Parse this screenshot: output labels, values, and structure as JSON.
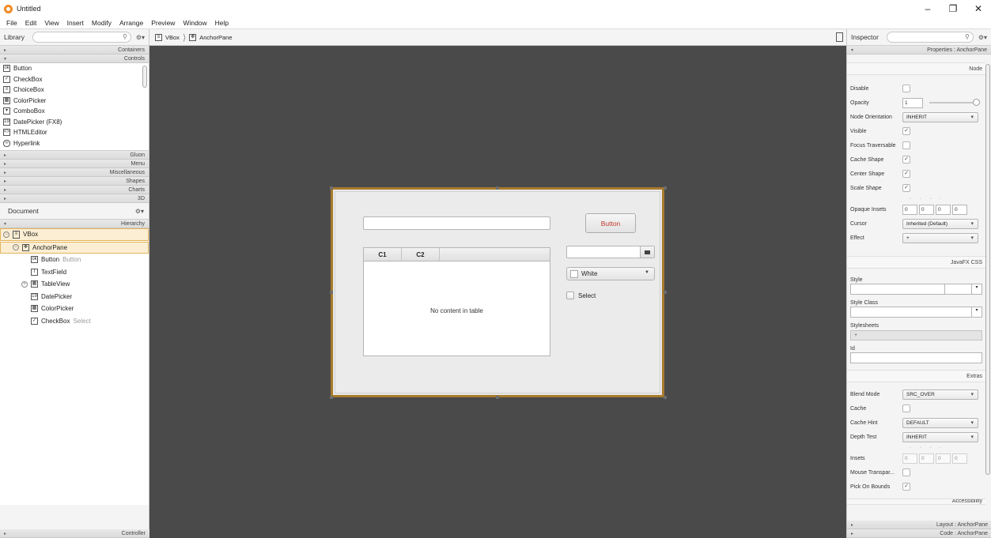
{
  "window": {
    "title": "Untitled",
    "controls": [
      "–",
      "❐",
      "✕"
    ]
  },
  "menubar": [
    "File",
    "Edit",
    "View",
    "Insert",
    "Modify",
    "Arrange",
    "Preview",
    "Window",
    "Help"
  ],
  "library": {
    "title": "Library",
    "sections_top": [
      "Containers",
      "Controls"
    ],
    "controls": [
      {
        "label": "Button",
        "icon": "button-icon"
      },
      {
        "label": "CheckBox",
        "icon": "checkbox-icon"
      },
      {
        "label": "ChoiceBox",
        "icon": "choicebox-icon"
      },
      {
        "label": "ColorPicker",
        "icon": "colorpicker-icon"
      },
      {
        "label": "ComboBox",
        "icon": "combobox-icon"
      },
      {
        "label": "DatePicker  (FX8)",
        "icon": "datepicker-icon"
      },
      {
        "label": "HTMLEditor",
        "icon": "htmleditor-icon"
      },
      {
        "label": "Hyperlink",
        "icon": "hyperlink-icon"
      }
    ],
    "sections_bottom": [
      "Gluon",
      "Menu",
      "Miscellaneous",
      "Shapes",
      "Charts",
      "3D"
    ]
  },
  "document": {
    "title": "Document",
    "section": "Hierarchy",
    "items": [
      {
        "label": "VBox",
        "extra": ""
      },
      {
        "label": "AnchorPane",
        "extra": ""
      },
      {
        "label": "Button",
        "extra": "Button"
      },
      {
        "label": "TextField",
        "extra": ""
      },
      {
        "label": "TableView",
        "extra": ""
      },
      {
        "label": "DatePicker",
        "extra": ""
      },
      {
        "label": "ColorPicker",
        "extra": ""
      },
      {
        "label": "CheckBox",
        "extra": "Select"
      }
    ],
    "controller": "Controller"
  },
  "breadcrumb": [
    "VBox",
    "AnchorPane"
  ],
  "canvas": {
    "button_label": "Button",
    "table_columns": [
      "C1",
      "C2"
    ],
    "table_placeholder": "No content in table",
    "color_value": "White",
    "checkbox_label": "Select"
  },
  "inspector": {
    "title": "Inspector",
    "properties_header": "Properties : AnchorPane",
    "node_header": "Node",
    "node": {
      "disable": "Disable",
      "opacity": "Opacity",
      "opacity_value": "1",
      "opacity_level": 1.0,
      "node_orientation": "Node Orientation",
      "node_orientation_value": "INHERIT",
      "visible": "Visible",
      "focus_traversable": "Focus Traversable",
      "cache_shape": "Cache Shape",
      "center_shape": "Center Shape",
      "scale_shape": "Scale Shape",
      "opaque_insets": "Opaque Insets",
      "opaque_insets_values": [
        "0",
        "0",
        "0",
        "0"
      ],
      "cursor": "Cursor",
      "cursor_value": "Inherited (Default)",
      "effect": "Effect",
      "effect_value": "+"
    },
    "javafx_css_header": "JavaFX CSS",
    "css": {
      "style": "Style",
      "style_class": "Style Class",
      "stylesheets": "Stylesheets",
      "stylesheets_add": "+",
      "id": "Id"
    },
    "extras_header": "Extras",
    "extras": {
      "blend_mode": "Blend Mode",
      "blend_mode_value": "SRC_OVER",
      "cache": "Cache",
      "cache_hint": "Cache Hint",
      "cache_hint_value": "DEFAULT",
      "depth_test": "Depth Test",
      "depth_test_value": "INHERIT",
      "insets": "Insets",
      "insets_values": [
        "0",
        "0",
        "0",
        "0"
      ],
      "mouse_transparent": "Mouse Transpar...",
      "pick_on_bounds": "Pick On Bounds"
    },
    "accessibility_header": "Accessibility",
    "layout_section": "Layout : AnchorPane",
    "code_section": "Code : AnchorPane"
  }
}
